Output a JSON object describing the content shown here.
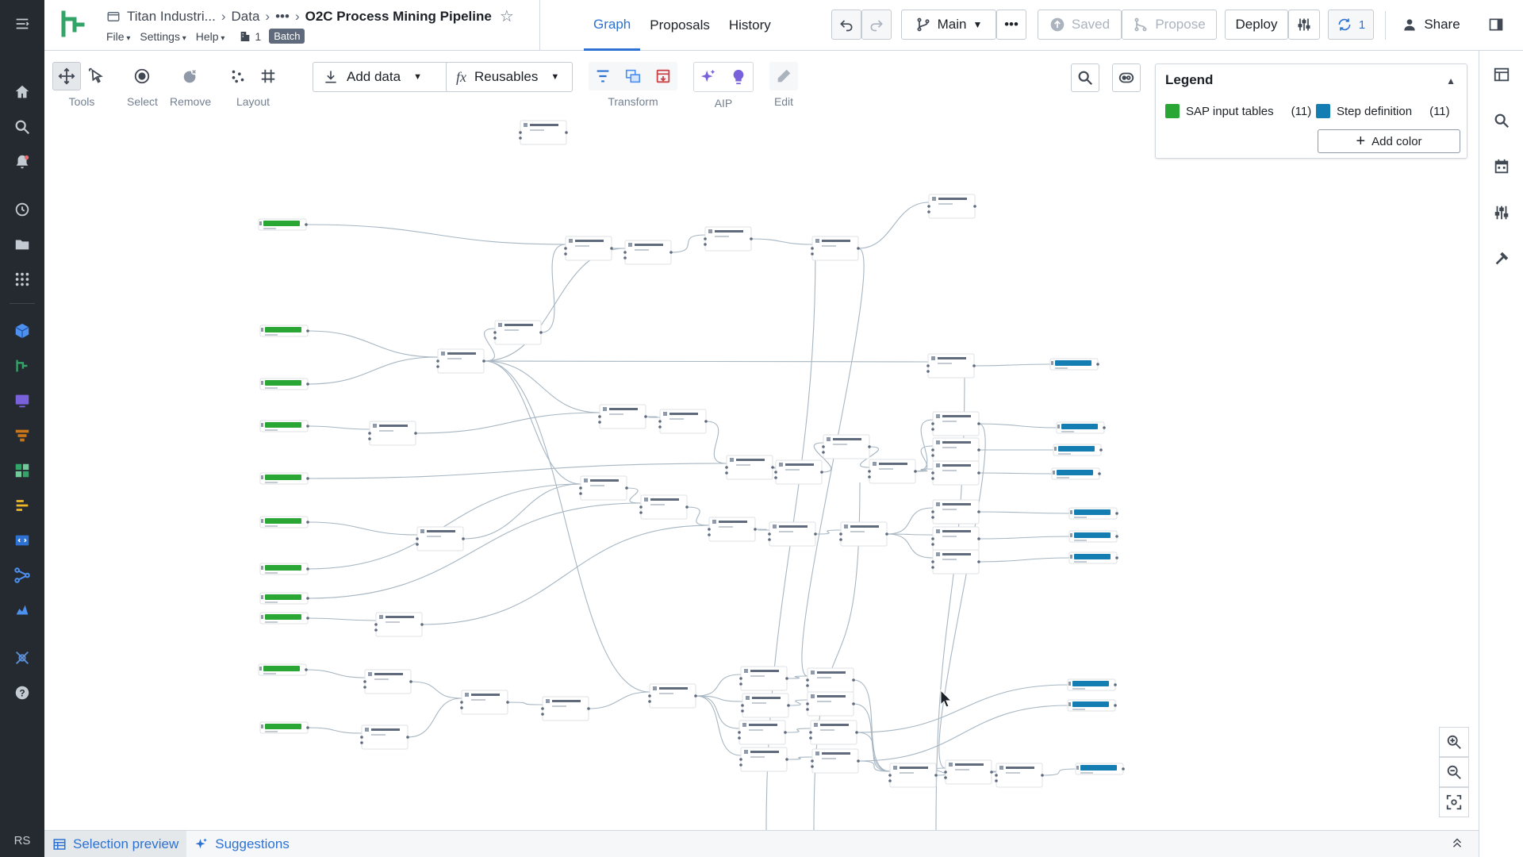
{
  "header": {
    "breadcrumbs": [
      "Titan Industri...",
      "Data",
      "•••",
      "O2C Process Mining Pipeline"
    ],
    "menus": [
      "File",
      "Settings",
      "Help"
    ],
    "branch_count": "1",
    "batch_label": "Batch",
    "tabs": [
      {
        "label": "Graph",
        "active": true
      },
      {
        "label": "Proposals",
        "active": false
      },
      {
        "label": "History",
        "active": false
      }
    ],
    "branch_label": "Main",
    "saved_label": "Saved",
    "propose_label": "Propose",
    "deploy_label": "Deploy",
    "sync_count": "1",
    "share_label": "Share"
  },
  "toolbar": {
    "tools_label": "Tools",
    "select_label": "Select",
    "remove_label": "Remove",
    "layout_label": "Layout",
    "add_data_label": "Add data",
    "reusables_label": "Reusables",
    "transform_label": "Transform",
    "aip_label": "AIP",
    "edit_label": "Edit"
  },
  "legend": {
    "title": "Legend",
    "items": [
      {
        "label": "SAP input tables",
        "count": "(11)",
        "color": "#29a634"
      },
      {
        "label": "Step definition",
        "count": "(11)",
        "color": "#147eb3"
      }
    ],
    "add_color_label": "Add color"
  },
  "bottom": {
    "selection_preview_label": "Selection preview",
    "suggestions_label": "Suggestions"
  },
  "rail": {
    "user_initials": "RS"
  },
  "graph_colors": {
    "input": "#29a634",
    "output": "#147eb3",
    "edge": "#a7b6c2",
    "node_border": "#dce0e5"
  }
}
